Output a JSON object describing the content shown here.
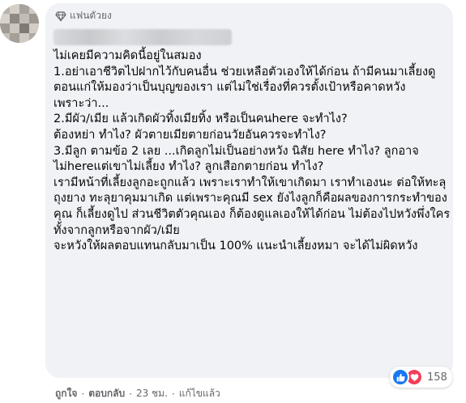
{
  "comment": {
    "badge_label": "แฟนตัวยง",
    "badge_icon": "diamond-icon",
    "text": "ไม่เคยมีความคิดนี้อยู่ในสมอง\n1.อย่าเอาชีวิตไปฝากไว้กับคนอื่น ช่วยเหลือตัวเองให้ได้ก่อน ถ้ามีคนมาเลี้ยงดูตอนแก่ให้มองว่าเป็นบุญของเรา แต่ไม่ใช่เรื่องที่ควรตั้งเป้าหรือคาดหวัง\nเพราะว่า...\n2.มีผัว/เมีย แล้วเกิดผัวทิ้งเมียทิ้ง หรือเป็นคนhere จะทำไง?\nต้องหย่า ทำไง? ผัวตายเมียตายก่อนวัยอันควรจะทำไง?\n3.มีลูก ตามข้อ 2 เลย ...เกิดลูกไม่เป็นอย่างหวัง นิสัย here ทำไง? ลูกอาจไม่hereแต่เขาไม่เลี้ยง ทำไง? ลูกเสือกตายก่อน ทำไง?\nเรามีหน้าที่เลี้ยงลูกอะถูกแล้ว เพราะเราทำให้เขาเกิดมา เราทำเองนะ ต่อให้ทะลุถุงยาง ทะลุยาคุมมาเกิด แต่เพราะคุณมี sex ยังไงลูกก็คือผลของการกระทำของคุณ ก็เลี้ยงดูไป ส่วนชีวิตตัวคุณเอง ก็ต้องดูแลเองให้ได้ก่อน ไม่ต้องไปหวังพึ่งใครทั้งจากลูกหรือจากผัว/เมีย\nจะหวังให้ผลตอบแทนกลับมาเป็น 100% แนะนำเลี้ยงหมา จะได้ไม่ผิดหวัง"
  },
  "reactions": {
    "icons": [
      "like-icon",
      "love-icon"
    ],
    "count": "158",
    "like_color": "#1877f2",
    "love_color": "#f33e58"
  },
  "actions": {
    "like_label": "ถูกใจ",
    "reply_label": "ตอบกลับ",
    "time": "23 ชม.",
    "edited": "แก้ไขแล้ว",
    "separator": "·"
  },
  "colors": {
    "bubble_bg": "#f0f2f5",
    "text": "#050505",
    "meta": "#65676b"
  }
}
